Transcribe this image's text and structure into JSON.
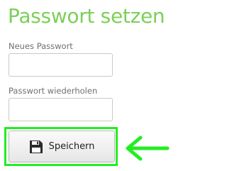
{
  "page": {
    "title": "Passwort setzen"
  },
  "form": {
    "new_password_label": "Neues Passwort",
    "new_password_value": "",
    "repeat_password_label": "Passwort wiederholen",
    "repeat_password_value": "",
    "save_label": "Speichern"
  },
  "icons": {
    "save": "floppy-disk-icon",
    "annotation": "arrow-left-icon"
  },
  "colors": {
    "title": "#7ccf57",
    "highlight": "#22ee22"
  }
}
